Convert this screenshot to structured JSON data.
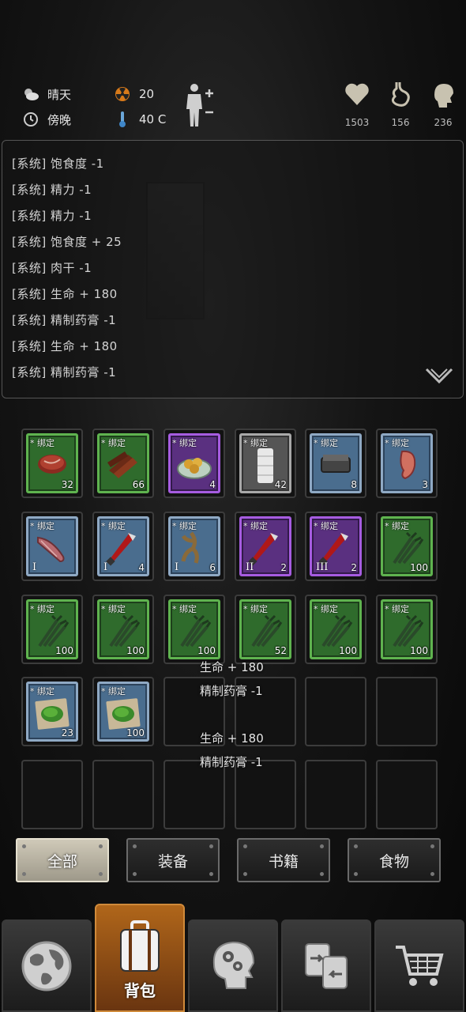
{
  "status": {
    "weather": "晴天",
    "time_of_day": "傍晚",
    "radiation": "20",
    "temperature": "40 C",
    "health": "1503",
    "hunger": "156",
    "sanity": "236"
  },
  "log": [
    "[系统] 饱食度 -1",
    "[系统] 精力 -1",
    "[系统] 精力 -1",
    "[系统] 饱食度 + 25",
    "[系统] 肉干 -1",
    "[系统] 生命 + 180",
    "[系统] 精制药膏 -1",
    "[系统] 生命 + 180",
    "[系统] 精制药膏 -1"
  ],
  "bind_label": "* 绑定",
  "inventory": [
    {
      "icon": "steak-icon",
      "rarity": "green",
      "qty": "32",
      "tier": ""
    },
    {
      "icon": "jerky-icon",
      "rarity": "green",
      "qty": "66",
      "tier": ""
    },
    {
      "icon": "fried-food-plate-icon",
      "rarity": "purple",
      "qty": "4",
      "tier": ""
    },
    {
      "icon": "bandage-icon",
      "rarity": "gray",
      "qty": "42",
      "tier": ""
    },
    {
      "icon": "whetstone-icon",
      "rarity": "blue",
      "qty": "8",
      "tier": ""
    },
    {
      "icon": "ear-icon",
      "rarity": "blue",
      "qty": "3",
      "tier": ""
    },
    {
      "icon": "muscle-icon",
      "rarity": "blue",
      "qty": "",
      "tier": "I"
    },
    {
      "icon": "bloody-machete-icon",
      "rarity": "blue",
      "qty": "4",
      "tier": "I"
    },
    {
      "icon": "withered-root-icon",
      "rarity": "blue",
      "qty": "6",
      "tier": "I"
    },
    {
      "icon": "bloody-machete-icon",
      "rarity": "purple",
      "qty": "2",
      "tier": "II"
    },
    {
      "icon": "bloody-machete-icon",
      "rarity": "purple",
      "qty": "2",
      "tier": "III"
    },
    {
      "icon": "herb-bundle-icon",
      "rarity": "green",
      "qty": "100",
      "tier": ""
    },
    {
      "icon": "herb-bundle-icon",
      "rarity": "green",
      "qty": "100",
      "tier": ""
    },
    {
      "icon": "herb-bundle-icon",
      "rarity": "green",
      "qty": "100",
      "tier": ""
    },
    {
      "icon": "herb-bundle-icon",
      "rarity": "green",
      "qty": "100",
      "tier": ""
    },
    {
      "icon": "herb-bundle-icon",
      "rarity": "green",
      "qty": "52",
      "tier": ""
    },
    {
      "icon": "herb-bundle-icon",
      "rarity": "green",
      "qty": "100",
      "tier": ""
    },
    {
      "icon": "herb-bundle-icon",
      "rarity": "green",
      "qty": "100",
      "tier": ""
    },
    {
      "icon": "herb-paper-icon",
      "rarity": "blue",
      "qty": "23",
      "tier": ""
    },
    {
      "icon": "herb-paper-icon",
      "rarity": "blue",
      "qty": "100",
      "tier": ""
    }
  ],
  "floating": [
    {
      "line1": "生命 + 180",
      "line2": "精制药膏 -1"
    },
    {
      "line1": "生命 + 180",
      "line2": "精制药膏 -1"
    }
  ],
  "filters": [
    "全部",
    "装备",
    "书籍",
    "食物"
  ],
  "nav": {
    "active_label": "背包"
  },
  "colors": {
    "green_frame": "#5fb34f",
    "blue_frame": "#8fa9c4",
    "purple_frame": "#a65ce0",
    "gray_frame": "#a8a8a8",
    "active_nav": "#b0661a"
  }
}
